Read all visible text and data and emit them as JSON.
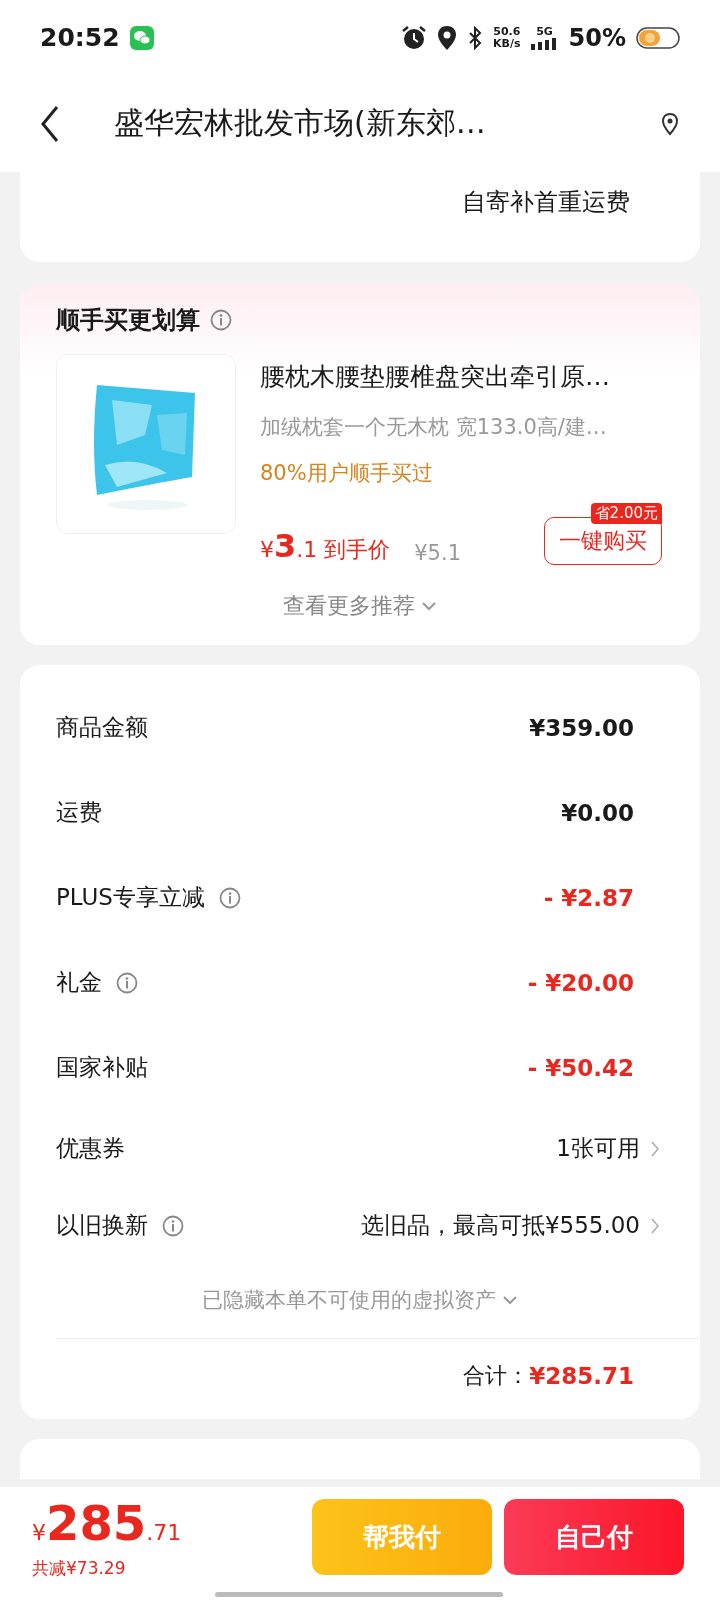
{
  "status_bar": {
    "time": "20:52",
    "net_speed": "50.6",
    "net_unit": "KB/s",
    "network": "5G",
    "battery": "50%"
  },
  "header": {
    "title": "盛华宏林批发市场(新东郊…"
  },
  "shipping_card": {
    "note": "自寄补首重运费"
  },
  "addon": {
    "title": "顺手买更划算",
    "product": {
      "name": "腰枕木腰垫腰椎盘突出牵引原…",
      "spec": "加绒枕套一个无木枕   宽133.0高/建…",
      "social": "80%用户顺手买过",
      "price_symbol": "¥",
      "price_int": "3",
      "price_dec": ".1",
      "price_label": "到手价",
      "original_price": "¥5.1",
      "save_badge": "省2.00元",
      "buy_button": "一键购买"
    },
    "more": "查看更多推荐"
  },
  "fees": {
    "rows": [
      {
        "kind": "amount",
        "label": "商品金额",
        "info": false,
        "value": "¥359.00"
      },
      {
        "kind": "amount",
        "label": "运费",
        "info": false,
        "value": "¥0.00"
      },
      {
        "kind": "discount",
        "label": "PLUS专享立减",
        "info": true,
        "value": "- ¥2.87"
      },
      {
        "kind": "discount",
        "label": "礼金",
        "info": true,
        "value": "- ¥20.00"
      },
      {
        "kind": "discount",
        "label": "国家补贴",
        "info": false,
        "value": "- ¥50.42"
      },
      {
        "kind": "link",
        "label": "优惠券",
        "info": false,
        "value": "1张可用"
      },
      {
        "kind": "link",
        "label": "以旧换新",
        "info": true,
        "value": "选旧品，最高可抵¥555.00"
      }
    ],
    "hidden_note": "已隐藏本单不可使用的虚拟资产",
    "total_label": "合计：",
    "total": "¥285.71"
  },
  "bottom_bar": {
    "symbol": "¥",
    "amount_int": "285",
    "amount_dec": ".71",
    "saved": "共减¥73.29",
    "buttons": [
      {
        "kind": "secondary",
        "label": "帮我付"
      },
      {
        "kind": "primary",
        "label": "自己付"
      }
    ]
  }
}
